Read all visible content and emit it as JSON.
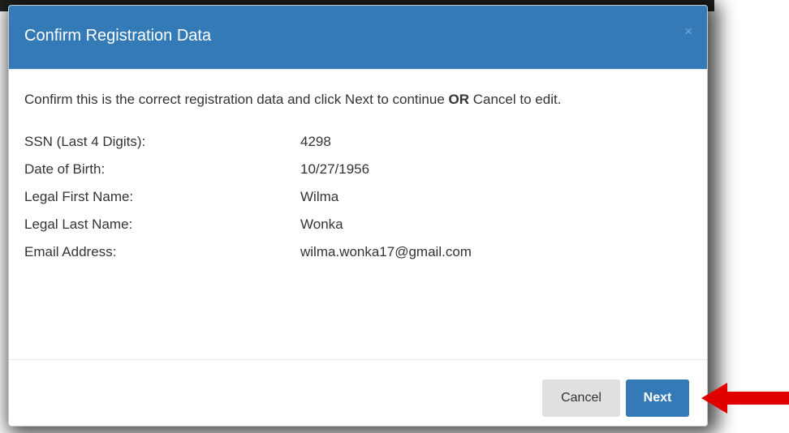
{
  "dialog": {
    "title": "Confirm Registration Data",
    "close_symbol": "×",
    "intro_before": "Confirm this is the correct registration data and click Next to continue ",
    "intro_bold": "OR",
    "intro_after": " Cancel to edit.",
    "fields": [
      {
        "label": "SSN (Last 4 Digits):",
        "value": "4298"
      },
      {
        "label": "Date of Birth:",
        "value": "10/27/1956"
      },
      {
        "label": "Legal First Name:",
        "value": "Wilma"
      },
      {
        "label": "Legal Last Name:",
        "value": "Wonka"
      },
      {
        "label": "Email Address:",
        "value": "wilma.wonka17@gmail.com"
      }
    ],
    "cancel_label": "Cancel",
    "next_label": "Next"
  },
  "colors": {
    "header_bg": "#337ab7",
    "primary_button": "#337ab7",
    "cancel_button": "#e0e0e0",
    "annotation_arrow": "#e00000"
  },
  "icons": {
    "close": "close-icon",
    "annotation": "red-arrow-icon"
  }
}
